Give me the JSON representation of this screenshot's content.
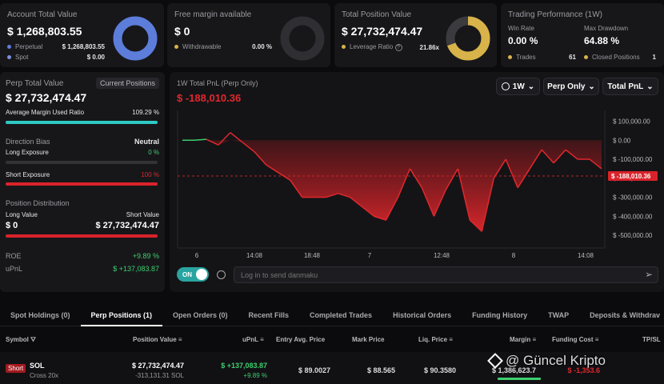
{
  "summary": {
    "account": {
      "title": "Account Total Value",
      "value": "$ 1,268,803.55",
      "perpetual_label": "Perpetual",
      "perpetual_value": "$ 1,268,803.55",
      "spot_label": "Spot",
      "spot_value": "$ 0.00",
      "perp_color": "#5d7ddb",
      "spot_color": "#7f8fe0"
    },
    "margin": {
      "title": "Free margin available",
      "value": "$ 0",
      "withdrawable_label": "Withdrawable",
      "withdrawable_value": "0.00 %"
    },
    "position": {
      "title": "Total Position Value",
      "value": "$ 27,732,474.47",
      "leverage_label": "Leverage Ratio",
      "leverage_value": "21.86x",
      "ring_color": "#d8b34a"
    },
    "performance": {
      "title": "Trading Performance (1W)",
      "win_rate_label": "Win Rate",
      "win_rate_value": "0.00 %",
      "drawdown_label": "Max Drawdown",
      "drawdown_value": "64.88 %",
      "trades_label": "Trades",
      "trades_value": "61",
      "closed_label": "Closed Positions",
      "closed_value": "1"
    }
  },
  "perp_panel": {
    "title": "Perp Total Value",
    "current_positions_label": "Current Positions",
    "value": "$ 27,732,474.47",
    "margin_ratio_label": "Average Margin Used Ratio",
    "margin_ratio_value": "109.29 %",
    "margin_ratio_fraction": 1.0,
    "direction_label": "Direction Bias",
    "direction_value": "Neutral",
    "long_exposure_label": "Long Exposure",
    "long_exposure_value": "0 %",
    "long_exposure_fraction": 0.0,
    "short_exposure_label": "Short Exposure",
    "short_exposure_value": "100 %",
    "short_exposure_fraction": 1.0,
    "distribution_label": "Position Distribution",
    "long_value_label": "Long Value",
    "short_value_label": "Short Value",
    "long_value": "$ 0",
    "short_value": "$ 27,732,474.47",
    "roe_label": "ROE",
    "roe_value": "+9.89 %",
    "upnl_label": "uPnL",
    "upnl_value": "$ +137,083.87"
  },
  "chart_panel": {
    "title": "1W Total PnL (Perp Only)",
    "value": "$ -188,010.36",
    "timeframe": "1W",
    "filter": "Perp Only",
    "metric": "Total PnL",
    "toggle_label": "ON",
    "danmaku_placeholder": "Log in to send danmaku"
  },
  "chart_data": {
    "type": "area",
    "x_tick_labels": [
      "6",
      "14:08",
      "18:48",
      "7",
      "12:48",
      "8",
      "14:08"
    ],
    "y_tick_labels": [
      "$ 100,000.00",
      "$ 0.00",
      "$ -100,000.00",
      "$ -200,000.00",
      "$ -300,000.00",
      "$ -400,000.00",
      "$ -500,000.00"
    ],
    "ylim": [
      -550000,
      140000
    ],
    "current_label": "$ -188,010.36",
    "current_value": -188010.36,
    "values": [
      0,
      0,
      5000,
      -25000,
      40000,
      -10000,
      -60000,
      -130000,
      -170000,
      -210000,
      -300000,
      -300000,
      -300000,
      -280000,
      -300000,
      -350000,
      -400000,
      -420000,
      -300000,
      -150000,
      -250000,
      -400000,
      -260000,
      -150000,
      -420000,
      -480000,
      -200000,
      -100000,
      -250000,
      -150000,
      -50000,
      -120000,
      -50000,
      -100000,
      -100000,
      -150000
    ],
    "positive_color": "#3ecf6e",
    "negative_color": "#e0282d"
  },
  "tabs": [
    "Spot Holdings (0)",
    "Perp Positions (1)",
    "Open Orders (0)",
    "Recent Fills",
    "Completed Trades",
    "Historical Orders",
    "Funding History",
    "TWAP",
    "Deposits & Withdrav"
  ],
  "table": {
    "headers": {
      "symbol": "Symbol",
      "position_value": "Position Value",
      "upnl": "uPnL",
      "entry": "Entry Avg. Price",
      "mark": "Mark Price",
      "liq": "Liq. Price",
      "margin": "Margin",
      "funding": "Funding Cost",
      "tpsl": "TP/SL"
    },
    "row": {
      "side": "Short",
      "symbol": "SOL",
      "mode": "Cross 20x",
      "position_value": "$ 27,732,474.47",
      "position_qty": "-313,131.31 SOL",
      "upnl": "$ +137,083.87",
      "upnl_pct": "+9.89 %",
      "entry": "$ 89.0027",
      "mark": "$ 88.565",
      "liq": "$ 90.3580",
      "margin": "$ 1,386,623.7",
      "funding": "$ -1,353.6"
    }
  },
  "watermark": "@ Güncel Kripto"
}
